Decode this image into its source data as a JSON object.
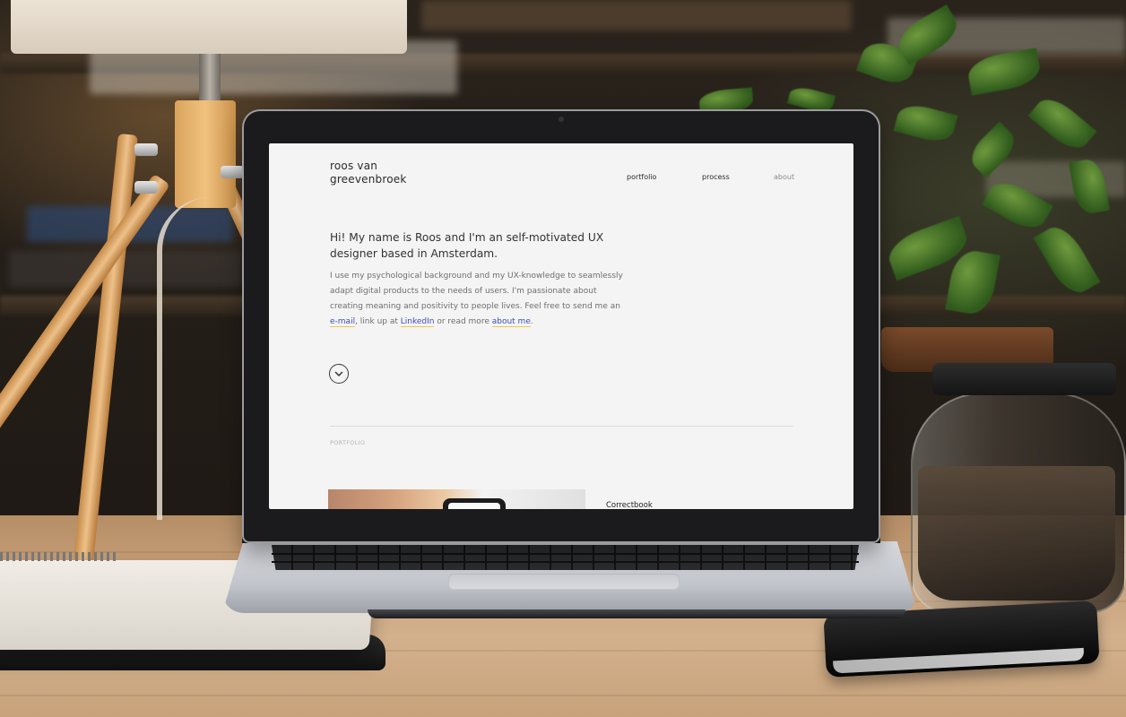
{
  "site": {
    "logo": "roos van\ngreevenbroek",
    "nav": [
      {
        "label": "portfolio"
      },
      {
        "label": "process"
      },
      {
        "label": "about"
      }
    ]
  },
  "hero": {
    "title": "Hi! My name is Roos and I'm an self-motivated UX designer based in Amsterdam.",
    "body_part1": "I use my psychological background and my UX-knowledge to seamlessly adapt digital products to the needs of users. I'm passionate about creating meaning and positivity to people lives. Feel free to send me an ",
    "link_email": "e-mail",
    "body_part2": ", link up at ",
    "link_linkedin": "LinkedIn",
    "body_part3": " or read more ",
    "link_about": "about me",
    "body_part4": "."
  },
  "portfolio": {
    "section_label": "PORTFOLIO",
    "first_project_title": "Correctbook"
  },
  "colors": {
    "link": "#3b4fb3",
    "link_underline": "#f1c64a",
    "text": "#333333",
    "muted": "#6e6e6e"
  },
  "icons": {
    "scroll_down": "chevron-down-icon"
  }
}
